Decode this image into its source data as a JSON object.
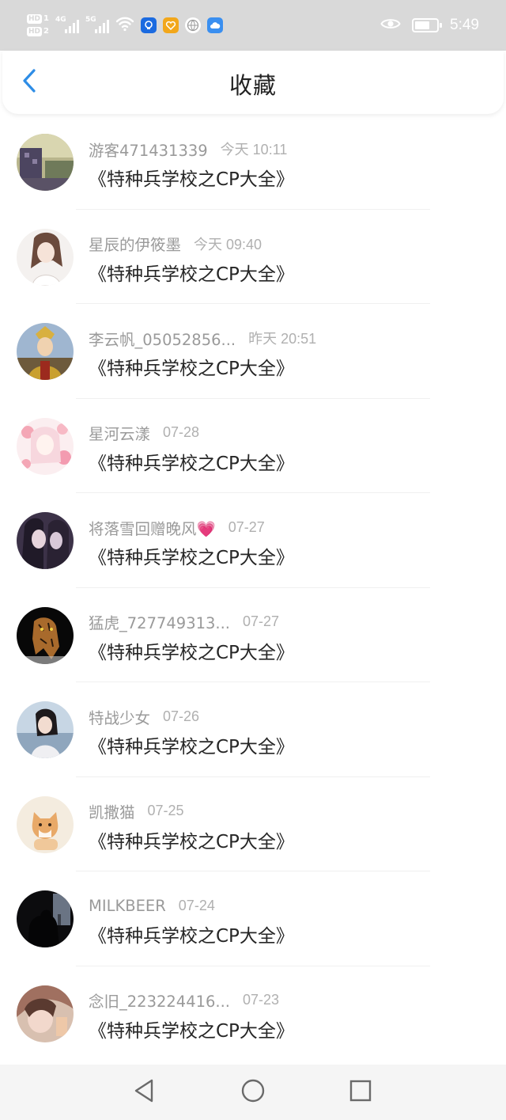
{
  "status_bar": {
    "hd1_label": "HD",
    "hd1_sim": "1",
    "hd2_label": "HD",
    "hd2_sim": "2",
    "signal1_label": "4G",
    "signal2_label": "5G",
    "time": "5:49",
    "battery_level_fraction": 0.7,
    "icons": [
      "wifi-icon",
      "lightbulb-icon",
      "heart-badge-icon",
      "globe-icon",
      "cloud-icon",
      "eye-icon",
      "battery-icon"
    ]
  },
  "header": {
    "title": "收藏",
    "back_icon": "chevron-left-icon"
  },
  "accent_color": "#2e8de6",
  "items": [
    {
      "user": "游客471431339",
      "time": "今天 10:11",
      "work": "《特种兵学校之CP大全》"
    },
    {
      "user": "星辰的伊筱墨",
      "time": "今天 09:40",
      "work": "《特种兵学校之CP大全》"
    },
    {
      "user": "李云帆_05052856...",
      "time": "昨天 20:51",
      "work": "《特种兵学校之CP大全》"
    },
    {
      "user": "星河云漾",
      "time": "07-28",
      "work": "《特种兵学校之CP大全》"
    },
    {
      "user": "将落雪回赠晚风💗",
      "time": "07-27",
      "work": "《特种兵学校之CP大全》"
    },
    {
      "user": "猛虎_727749313...",
      "time": "07-27",
      "work": "《特种兵学校之CP大全》"
    },
    {
      "user": "特战少女",
      "time": "07-26",
      "work": "《特种兵学校之CP大全》"
    },
    {
      "user": "凯撒猫",
      "time": "07-25",
      "work": "《特种兵学校之CP大全》"
    },
    {
      "user": "MILKBEER",
      "time": "07-24",
      "work": "《特种兵学校之CP大全》"
    },
    {
      "user": "念旧_223224416...",
      "time": "07-23",
      "work": "《特种兵学校之CP大全》"
    }
  ],
  "nav": {
    "back": "triangle-back-icon",
    "home": "circle-home-icon",
    "recents": "square-recents-icon"
  }
}
